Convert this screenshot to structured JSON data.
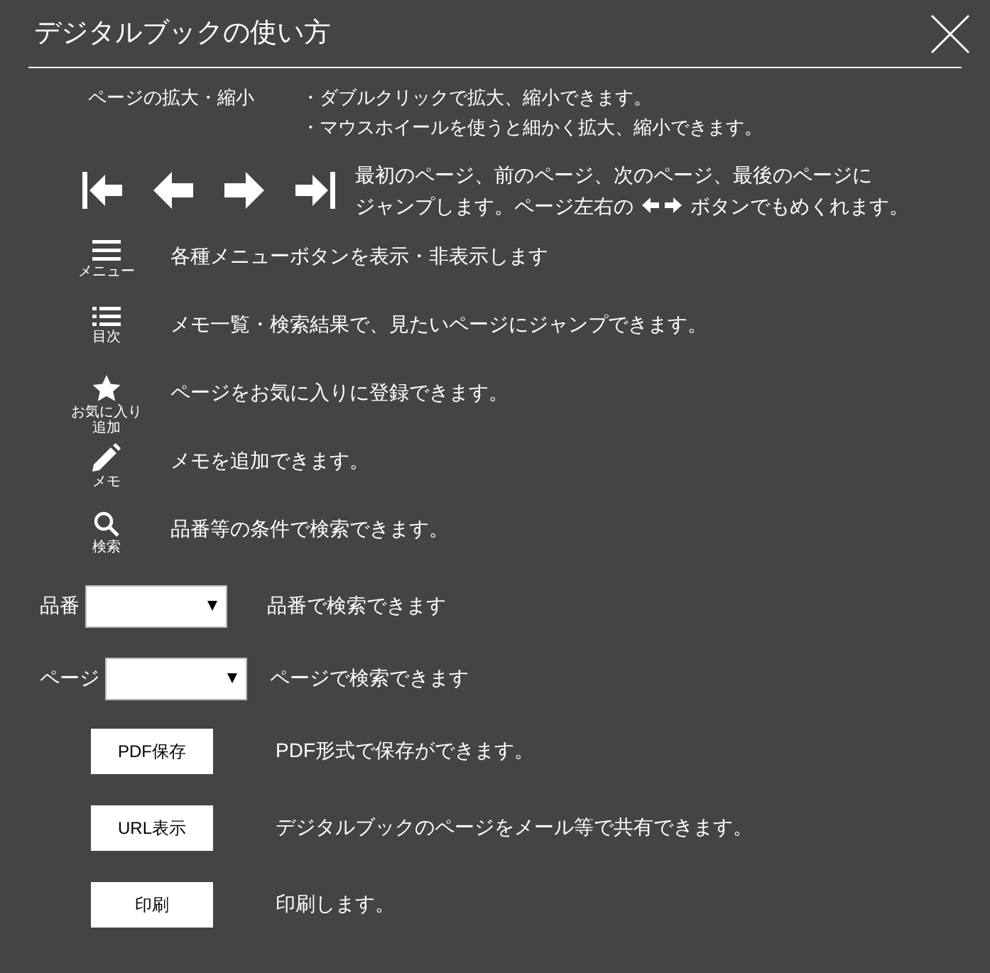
{
  "window": {
    "title": "デジタルブックの使い方"
  },
  "zoom": {
    "label": "ページの拡大・縮小",
    "lines": [
      "・ダブルクリックで拡大、縮小できます。",
      "・マウスホイールを使うと細かく拡大、縮小できます。"
    ]
  },
  "navigation": {
    "line1": "最初のページ、前のページ、次のページ、最後のページに",
    "line2_before": "ジャンプします。ページ左右の",
    "line2_after": "ボタンでもめくれます。"
  },
  "icon_rows": [
    {
      "kind": "menu",
      "caption": "メニュー",
      "description": "各種メニューボタンを表示・非表示します"
    },
    {
      "kind": "list",
      "caption": "目次",
      "description": "メモ一覧・検索結果で、見たいページにジャンプできます。"
    },
    {
      "kind": "star",
      "caption": "お気に入り追加",
      "description": "ページをお気に入りに登録できます。"
    },
    {
      "kind": "pencil",
      "caption": "メモ",
      "description": "メモを追加できます。"
    },
    {
      "kind": "search",
      "caption": "検索",
      "description": "品番等の条件で検索できます。"
    }
  ],
  "selects": [
    {
      "label": "品番",
      "description": "品番で検索できます"
    },
    {
      "label": "ページ",
      "description": "ページで検索できます"
    }
  ],
  "buttons": [
    {
      "label": "PDF保存",
      "description": "PDF形式で保存ができます。"
    },
    {
      "label": "URL表示",
      "description": "デジタルブックのページをメール等で共有できます。"
    },
    {
      "label": "印刷",
      "description": "印刷します。"
    }
  ]
}
